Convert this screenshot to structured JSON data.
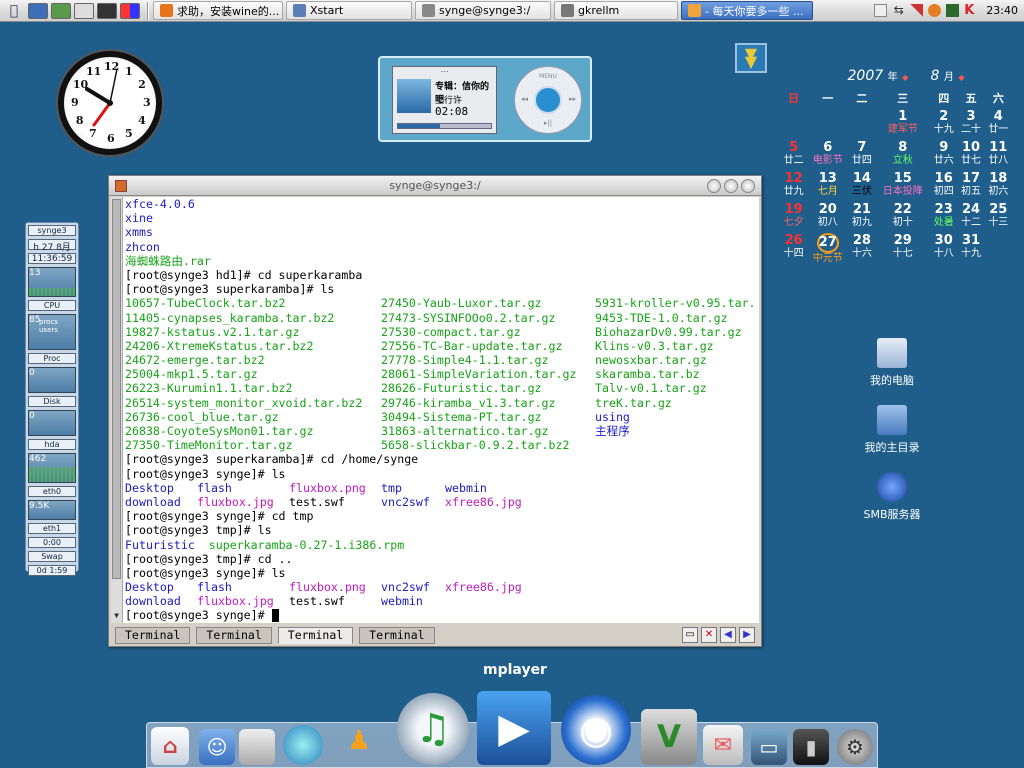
{
  "topbar": {
    "taskbar": [
      {
        "label": "求助，安装wine的...",
        "active": false
      },
      {
        "label": "Xstart",
        "active": false
      },
      {
        "label": "synge@synge3:/",
        "active": false
      },
      {
        "label": "gkrellm",
        "active": false
      },
      {
        "label": "- 每天你要多一些 ...",
        "active": true
      }
    ],
    "time": "23:40"
  },
  "analog_clock": {
    "numerals": [
      "12",
      "1",
      "2",
      "3",
      "4",
      "5",
      "6",
      "7",
      "8",
      "9",
      "10",
      "11"
    ],
    "hour_hand": "black",
    "minute_hand": "red",
    "second_hand": "black"
  },
  "player": {
    "title": "专辑：信你的吧",
    "track": "立行许",
    "time": "02:08",
    "menu": "MENU"
  },
  "calendar": {
    "year": "2007",
    "year_suffix": "年",
    "month": "8",
    "month_suffix": "月",
    "weekdays": [
      "日",
      "一",
      "二",
      "三",
      "四",
      "五",
      "六"
    ],
    "weeks": [
      [
        null,
        null,
        null,
        {
          "d": "1",
          "l": "建军节",
          "lc": "#ff6060"
        },
        {
          "d": "2",
          "l": "十九"
        },
        {
          "d": "3",
          "l": "二十"
        },
        {
          "d": "4",
          "l": "廿一"
        }
      ],
      [
        {
          "d": "5",
          "l": "廿二"
        },
        {
          "d": "6",
          "l": "电影节",
          "lc": "#ff70c0"
        },
        {
          "d": "7",
          "l": "廿四"
        },
        {
          "d": "8",
          "l": "立秋",
          "lc": "#60ff60"
        },
        {
          "d": "9",
          "l": "廿六"
        },
        {
          "d": "10",
          "l": "廿七"
        },
        {
          "d": "11",
          "l": "廿八"
        }
      ],
      [
        {
          "d": "12",
          "l": "廿九"
        },
        {
          "d": "13",
          "l": "七月",
          "lc": "#ffd040"
        },
        {
          "d": "14",
          "l": "三伏",
          "lc": "#000000"
        },
        {
          "d": "15",
          "l": "日本投降",
          "lc": "#ff70c0"
        },
        {
          "d": "16",
          "l": "初四"
        },
        {
          "d": "17",
          "l": "初五"
        },
        {
          "d": "18",
          "l": "初六"
        }
      ],
      [
        {
          "d": "19",
          "l": "七夕",
          "lc": "#ff6060"
        },
        {
          "d": "20",
          "l": "初八"
        },
        {
          "d": "21",
          "l": "初九"
        },
        {
          "d": "22",
          "l": "初十"
        },
        {
          "d": "23",
          "l": "处暑",
          "lc": "#60ff60"
        },
        {
          "d": "24",
          "l": "十二"
        },
        {
          "d": "25",
          "l": "十三"
        }
      ],
      [
        {
          "d": "26",
          "l": "十四"
        },
        {
          "d": "27",
          "l": "中元节",
          "lc": "#ff9c1a",
          "today": true
        },
        {
          "d": "28",
          "l": "十六"
        },
        {
          "d": "29",
          "l": "十七"
        },
        {
          "d": "30",
          "l": "十八"
        },
        {
          "d": "31",
          "l": "十九"
        },
        null
      ]
    ]
  },
  "desktop_icons": [
    {
      "label": "我的电脑",
      "icon": "computer-icon"
    },
    {
      "label": "我的主目录",
      "icon": "home-folder-icon"
    },
    {
      "label": "SMB服务器",
      "icon": "network-globe-icon"
    }
  ],
  "sysmon": {
    "host": "synge3",
    "date": "h 27 8月",
    "time": "11:36:59",
    "cpu_label": "CPU",
    "procs": "procs",
    "users": "users",
    "proc_label": "Proc",
    "disk_label": "Disk",
    "hda_label": "hda",
    "eth0_label": "eth0",
    "eth0_rate": "9.5K",
    "eth1_label": "eth1",
    "eth1_rate": "0:00",
    "swap_label": "Swap",
    "uptime": "0d  1:59",
    "cells": [
      "13",
      "85",
      "0",
      "0",
      "1",
      "462",
      "",
      "0"
    ]
  },
  "terminal": {
    "title": "synge@synge3:/",
    "lines": [
      {
        "t": "xfce-4.0.6",
        "c": "c-blue"
      },
      {
        "t": "xine",
        "c": "c-blue"
      },
      {
        "t": "xmms",
        "c": "c-blue"
      },
      {
        "t": "zhcon",
        "c": "c-blue"
      },
      {
        "t": "海蜘蛛路由.rar",
        "c": "c-green"
      },
      {
        "t": "[root@synge3 hd1]# cd superkaramba",
        "c": "c-blk"
      },
      {
        "t": "[root@synge3 superkaramba]# ls",
        "c": "c-blk"
      }
    ],
    "ls1": [
      [
        {
          "t": "10657-TubeClock.tar.bz2",
          "c": "c-green"
        },
        {
          "t": "27450-Yaub-Luxor.tar.gz",
          "c": "c-green"
        },
        {
          "t": "5931-kroller-v0.95.tar.",
          "c": "c-green"
        }
      ],
      [
        {
          "t": "11405-cynapses_karamba.tar.bz2",
          "c": "c-green"
        },
        {
          "t": "27473-SYSINFOOo0.2.tar.gz",
          "c": "c-green"
        },
        {
          "t": "9453-TDE-1.0.tar.gz",
          "c": "c-green"
        }
      ],
      [
        {
          "t": "19827-kstatus.v2.1.tar.gz",
          "c": "c-green"
        },
        {
          "t": "27530-compact.tar.gz",
          "c": "c-green"
        },
        {
          "t": "BiohazarDv0.99.tar.gz",
          "c": "c-green"
        }
      ],
      [
        {
          "t": "24206-XtremeKstatus.tar.bz2",
          "c": "c-green"
        },
        {
          "t": "27556-TC-Bar-update.tar.gz",
          "c": "c-green"
        },
        {
          "t": "Klins-v0.3.tar.gz",
          "c": "c-green"
        }
      ],
      [
        {
          "t": "24672-emerge.tar.bz2",
          "c": "c-green"
        },
        {
          "t": "27778-Simple4-1.1.tar.gz",
          "c": "c-green"
        },
        {
          "t": "newosxbar.tar.gz",
          "c": "c-green"
        }
      ],
      [
        {
          "t": "25004-mkp1.5.tar.gz",
          "c": "c-green"
        },
        {
          "t": "28061-SimpleVariation.tar.gz",
          "c": "c-green"
        },
        {
          "t": "skaramba.tar.bz",
          "c": "c-green"
        }
      ],
      [
        {
          "t": "26223-Kurumin1.1.tar.bz2",
          "c": "c-green"
        },
        {
          "t": "28626-Futuristic.tar.gz",
          "c": "c-green"
        },
        {
          "t": "Talv-v0.1.tar.gz",
          "c": "c-green"
        }
      ],
      [
        {
          "t": "26514-system_monitor_xvoid.tar.bz2",
          "c": "c-green"
        },
        {
          "t": "29746-kiramba_v1.3.tar.gz",
          "c": "c-green"
        },
        {
          "t": "treK.tar.gz",
          "c": "c-green"
        }
      ],
      [
        {
          "t": "26736-cool_blue.tar.gz",
          "c": "c-green"
        },
        {
          "t": "30494-Sistema-PT.tar.gz",
          "c": "c-green"
        },
        {
          "t": "using",
          "c": "c-blue"
        }
      ],
      [
        {
          "t": "26838-CoyoteSysMon01.tar.gz",
          "c": "c-green"
        },
        {
          "t": "31863-alternatico.tar.gz",
          "c": "c-green"
        },
        {
          "t": "主程序",
          "c": "c-blue"
        }
      ],
      [
        {
          "t": "27350-TimeMonitor.tar.gz",
          "c": "c-green"
        },
        {
          "t": "5658-slickbar-0.9.2.tar.bz2",
          "c": "c-green"
        },
        {
          "t": "",
          "c": "c-blk"
        }
      ]
    ],
    "lines2": [
      {
        "t": "[root@synge3 superkaramba]# cd /home/synge",
        "c": "c-blk"
      },
      {
        "t": "[root@synge3 synge]# ls",
        "c": "c-blk"
      }
    ],
    "ls2": [
      [
        {
          "t": "Desktop",
          "c": "c-blue"
        },
        {
          "t": "flash",
          "c": "c-blue"
        },
        {
          "t": "fluxbox.png",
          "c": "c-mag"
        },
        {
          "t": "tmp",
          "c": "c-blue"
        },
        {
          "t": "webmin",
          "c": "c-blue"
        }
      ],
      [
        {
          "t": "download",
          "c": "c-blue"
        },
        {
          "t": "fluxbox.jpg",
          "c": "c-mag"
        },
        {
          "t": "test.swf",
          "c": "c-blk"
        },
        {
          "t": "vnc2swf",
          "c": "c-blue"
        },
        {
          "t": "xfree86.jpg",
          "c": "c-mag"
        }
      ]
    ],
    "lines3": [
      {
        "t": "[root@synge3 synge]# cd tmp",
        "c": "c-blk"
      },
      {
        "t": "[root@synge3 tmp]# ls",
        "c": "c-blk"
      },
      {
        "t": "Futuristic  superkaramba-0.27-1.i386.rpm",
        "c": "c-blue",
        "split": [
          "Futuristic",
          "  superkaramba-0.27-1.i386.rpm"
        ],
        "split_c": [
          "c-blue",
          "c-green"
        ]
      },
      {
        "t": "[root@synge3 tmp]# cd ..",
        "c": "c-blk"
      },
      {
        "t": "[root@synge3 synge]# ls",
        "c": "c-blk"
      }
    ],
    "ls3": [
      [
        {
          "t": "Desktop",
          "c": "c-blue"
        },
        {
          "t": "flash",
          "c": "c-blue"
        },
        {
          "t": "fluxbox.png",
          "c": "c-mag"
        },
        {
          "t": "vnc2swf",
          "c": "c-blue"
        },
        {
          "t": "xfree86.jpg",
          "c": "c-mag"
        }
      ],
      [
        {
          "t": "download",
          "c": "c-blue"
        },
        {
          "t": "fluxbox.jpg",
          "c": "c-mag"
        },
        {
          "t": "test.swf",
          "c": "c-blk"
        },
        {
          "t": "webmin",
          "c": "c-blue"
        },
        {
          "t": "",
          "c": "c-blk"
        }
      ]
    ],
    "prompt": "[root@synge3 synge]# ",
    "tabs": [
      {
        "label": "Terminal",
        "active": false
      },
      {
        "label": "Terminal",
        "active": false
      },
      {
        "label": "Terminal",
        "active": true
      },
      {
        "label": "Terminal",
        "active": false
      }
    ]
  },
  "dock": {
    "label": "mplayer",
    "items": [
      "home-icon",
      "finder-icon",
      "apple-settings-icon",
      "spring-icon",
      "aim-runner-icon",
      "itunes-icon",
      "clapper-icon",
      "quicktime-icon",
      "vim-icon",
      "mail-icon",
      "desktop-icon",
      "terminal-icon",
      "gear-icon"
    ]
  }
}
